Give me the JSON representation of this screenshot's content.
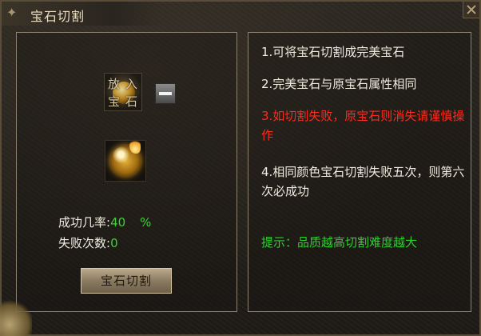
{
  "window": {
    "title": "宝石切割"
  },
  "left_panel": {
    "input_slot_chars": [
      "放",
      "入",
      "宝",
      "石"
    ],
    "success_rate_label": "成功几率:",
    "success_rate_value": "40",
    "success_rate_unit": "%",
    "fail_count_label": "失败次数:",
    "fail_count_value": "0",
    "action_button": "宝石切割"
  },
  "right_panel": {
    "rule1": "1.可将宝石切割成完美宝石",
    "rule2": "2.完美宝石与原宝石属性相同",
    "rule3": "3.如切割失败，原宝石则消失请谨慎操作",
    "rule4": "4.相同颜色宝石切割失败五次，则第六次必成功",
    "tip": "提示：品质越高切割难度越大"
  },
  "colors": {
    "warning": "#ff2a1e",
    "highlight": "#2bd12b",
    "text": "#f1ece0"
  },
  "icons": [
    "minus-icon",
    "gem-orb-icon",
    "close-icon"
  ]
}
